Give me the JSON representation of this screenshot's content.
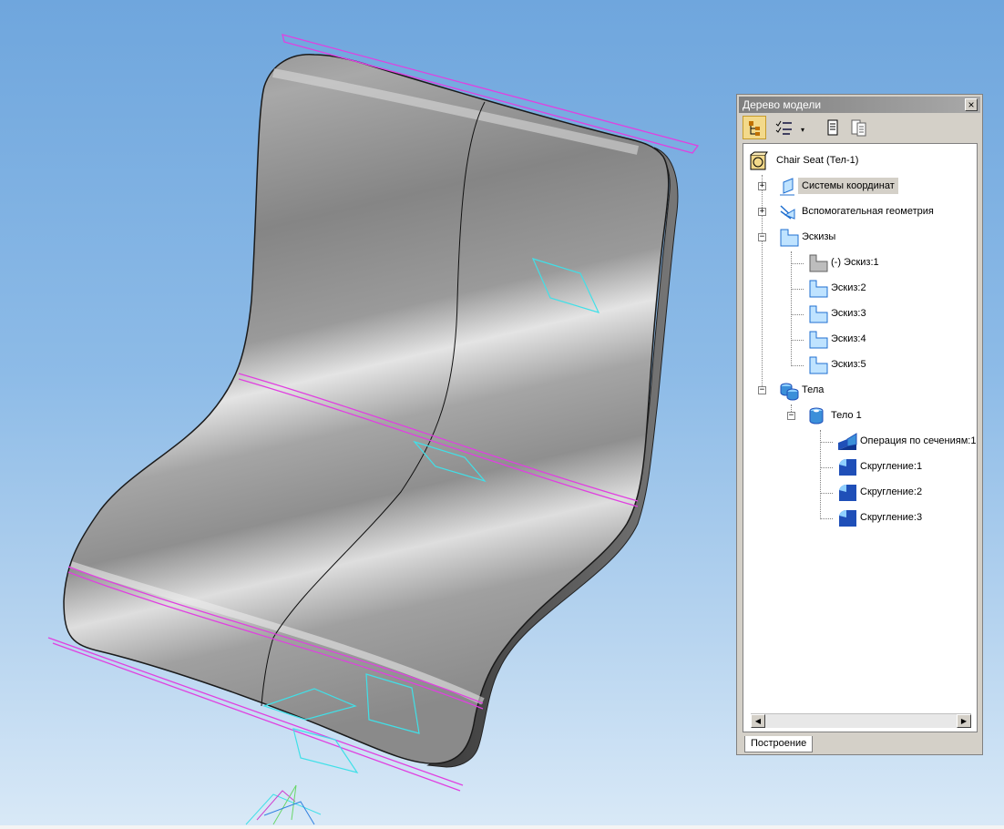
{
  "panel": {
    "title": "Дерево модели",
    "close_label": "×",
    "tab_label": "Построение"
  },
  "toolbar": {
    "buttons": [
      {
        "icon": "tree-structure-icon"
      },
      {
        "icon": "checklist-filter-icon"
      },
      {
        "icon": "document-icon"
      },
      {
        "icon": "document-list-icon"
      }
    ],
    "dropdown_arrow": "▾"
  },
  "tree": {
    "root": "Chair Seat (Тел-1)",
    "coord_systems": "Системы координат",
    "aux_geometry": "Вспомогательная геометрия",
    "sketches": "Эскизы",
    "sketch_items": [
      "(-) Эскиз:1",
      "Эскиз:2",
      "Эскиз:3",
      "Эскиз:4",
      "Эскиз:5"
    ],
    "bodies": "Тела",
    "body1": "Тело 1",
    "operations": [
      "Операция по сечениям:1",
      "Скругление:1",
      "Скругление:2",
      "Скругление:3"
    ]
  },
  "expanders": {
    "plus": "+",
    "minus": "−"
  },
  "scroll": {
    "left": "◀",
    "right": "▶"
  },
  "colors": {
    "viewport_top": "#6fa6dd",
    "viewport_bottom": "#d9e9f7",
    "surface": "#9a9a9a",
    "section_curve": "#e040e0",
    "sketch_plane": "#40e0e8",
    "sketch_icon": "#3b8fd9",
    "operation_icon": "#1f4fb8"
  }
}
